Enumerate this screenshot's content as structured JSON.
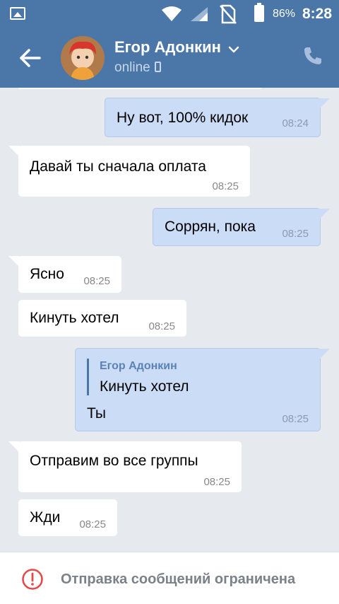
{
  "status_bar": {
    "battery_percent": "86%",
    "time": "8:28",
    "icons": [
      "image-icon",
      "wifi-icon",
      "signal-icon",
      "no-sim-icon",
      "battery-icon"
    ]
  },
  "header": {
    "name": "Егор Адонкин",
    "status": "online",
    "colors": {
      "bar": "#4a76a8",
      "status_text": "#c8d7ea"
    }
  },
  "messages": [
    {
      "dir": "out",
      "text": "Ну вот, 100% кидок",
      "time": "08:24"
    },
    {
      "dir": "in",
      "text": "Давай ты сначала оплата",
      "time": "08:25"
    },
    {
      "dir": "out",
      "text": "Соррян, пока",
      "time": "08:25"
    },
    {
      "dir": "in",
      "text": "Ясно",
      "time": "08:25"
    },
    {
      "dir": "in",
      "text": "Кинуть хотел",
      "time": "08:25"
    },
    {
      "dir": "out",
      "reply_name": "Егор Адонкин",
      "reply_text": "Кинуть хотел",
      "text": "Ты",
      "time": "08:25"
    },
    {
      "dir": "in",
      "text": "Отправим во все группы",
      "time": "08:25"
    },
    {
      "dir": "in",
      "text": "Жди",
      "time": "08:25"
    }
  ],
  "bottom": {
    "notice": "Отправка сообщений ограничена",
    "colors": {
      "icon": "#e64646",
      "text": "#7a8189"
    }
  }
}
